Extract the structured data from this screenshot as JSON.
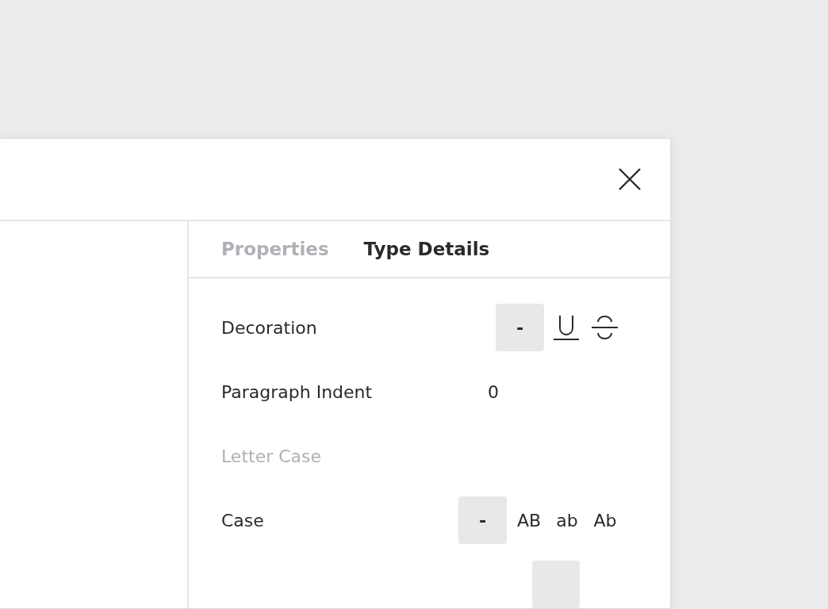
{
  "tabs": [
    {
      "label": "Properties",
      "selected": false
    },
    {
      "label": "Type Details",
      "selected": true
    }
  ],
  "decoration": {
    "label": "Decoration",
    "options": [
      {
        "kind": "none",
        "text": "-",
        "selected": true
      },
      {
        "kind": "underline",
        "selected": false
      },
      {
        "kind": "strikethrough",
        "selected": false
      }
    ]
  },
  "paragraph_indent": {
    "label": "Paragraph Indent",
    "value": "0"
  },
  "letter_case": {
    "heading": "Letter Case",
    "label": "Case",
    "options": [
      {
        "text": "-",
        "selected": true
      },
      {
        "text": "AB",
        "selected": false
      },
      {
        "text": "ab",
        "selected": false
      },
      {
        "text": "Ab",
        "selected": false
      }
    ]
  }
}
